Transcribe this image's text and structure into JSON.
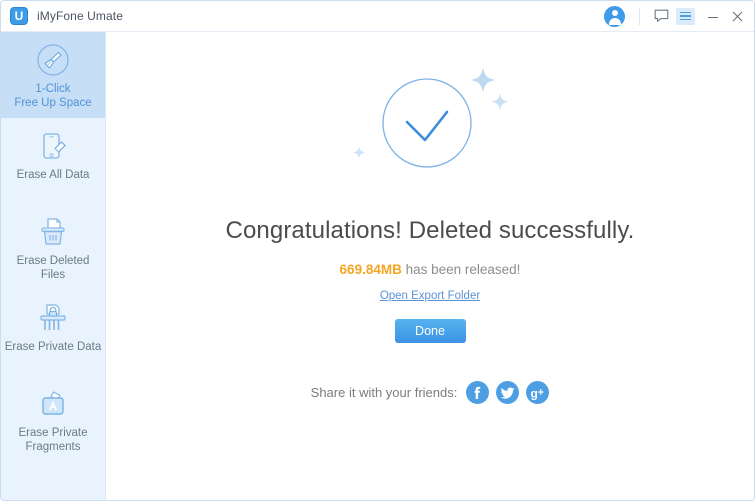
{
  "window": {
    "title": "iMyFone Umate",
    "logo_letter": "U"
  },
  "titlebar": {
    "account_icon": "account-avatar-icon",
    "feedback_icon": "feedback-icon",
    "menu_icon": "hamburger-menu-icon",
    "minimize_icon": "minimize-icon",
    "close_icon": "close-icon"
  },
  "sidebar": {
    "items": [
      {
        "label": "1-Click\nFree Up Space",
        "icon": "broom-circle-icon",
        "selected": true
      },
      {
        "label": "Erase All Data",
        "icon": "phone-eraser-icon",
        "selected": false
      },
      {
        "label": "Erase Deleted Files",
        "icon": "trash-document-icon",
        "selected": false
      },
      {
        "label": "Erase Private Data",
        "icon": "shredder-lock-icon",
        "selected": false
      },
      {
        "label": "Erase Private\nFragments",
        "icon": "app-folder-icon",
        "selected": false
      }
    ]
  },
  "main": {
    "graphic_icon": "checkmark-circle-sparkle-icon",
    "headline": "Congratulations! Deleted successfully.",
    "released_size": "669.84MB",
    "released_suffix": " has been released!",
    "export_link": "Open Export Folder",
    "done_label": "Done",
    "share_label": "Share it with your friends:",
    "social": [
      {
        "name": "facebook-icon",
        "glyph": "f"
      },
      {
        "name": "twitter-icon",
        "glyph": "t"
      },
      {
        "name": "google-plus-icon",
        "glyph": "g+"
      }
    ]
  },
  "colors": {
    "accent_blue": "#4e9ee4",
    "sidebar_bg": "#e9f3fd",
    "sidebar_selected_bg": "#c6ddf6",
    "released_orange": "#f5a623",
    "headline_gray": "#4c4c4c",
    "link_blue": "#5b93d6"
  }
}
